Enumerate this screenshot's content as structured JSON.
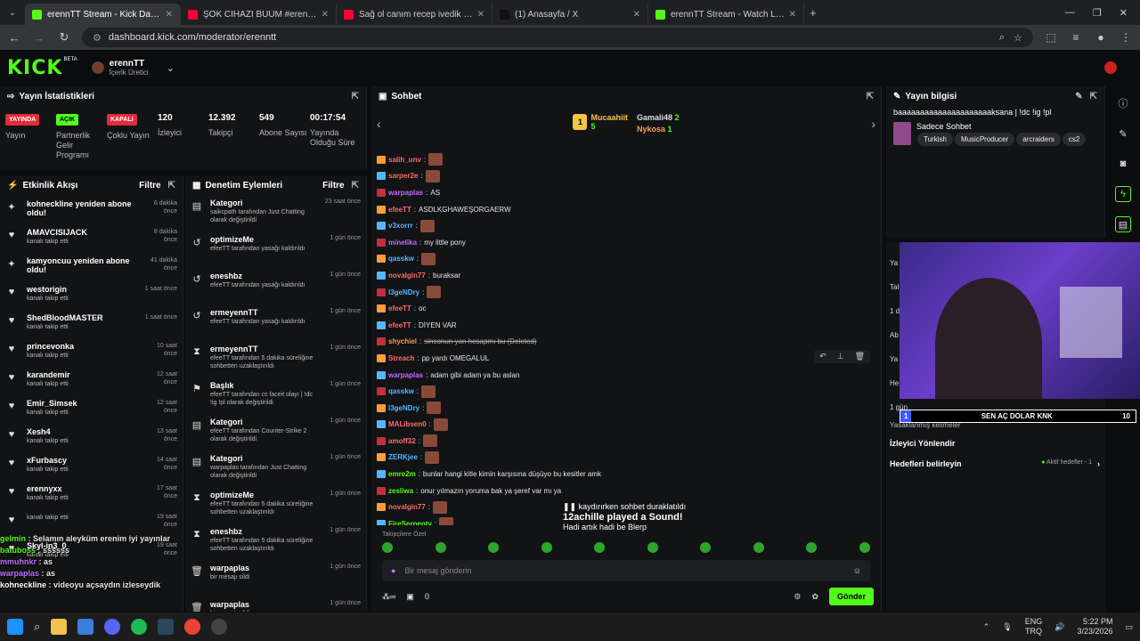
{
  "browser": {
    "tabs": [
      {
        "title": "erennTT Stream - Kick Dashbo",
        "fav": "#53fc18",
        "active": true
      },
      {
        "title": "ŞOK CİHAZI BUUM #erenntt #k",
        "fav": "#ff0033",
        "active": false
      },
      {
        "title": "Sağ ol canım recep ivedik - You",
        "fav": "#ff0033",
        "active": false
      },
      {
        "title": "(1) Anasayfa / X",
        "fav": "#111",
        "active": false
      },
      {
        "title": "erennTT Stream - Watch Live o",
        "fav": "#53fc18",
        "active": false
      }
    ],
    "url": "dashboard.kick.com/moderator/erenntt"
  },
  "header": {
    "logo": "KICK",
    "beta": "BETA",
    "channel": "erennTT",
    "role": "İçerik Üretici"
  },
  "stats": {
    "title": "Yayın İstatistikleri",
    "items": [
      {
        "badge": "YAYINDA",
        "badge_color": "#e22c3a",
        "label": "Yayın"
      },
      {
        "badge": "AÇIK",
        "badge_color": "#53fc18",
        "label": "Partnerlik Gelir Programı"
      },
      {
        "badge": "KAPALI",
        "badge_color": "#e22c3a",
        "label": "Çoklu Yayın"
      },
      {
        "value": "120",
        "label": "İzleyici"
      },
      {
        "value": "12.392",
        "label": "Takipçi"
      },
      {
        "value": "549",
        "label": "Abone Sayısı"
      },
      {
        "value": "00:17:54",
        "label": "Yayında Olduğu Süre"
      }
    ]
  },
  "activity": {
    "title": "Etkinlik Akışı",
    "filter": "Filtre",
    "items": [
      {
        "icon": "✦",
        "title": "kohneckline yeniden abone oldu!",
        "sub": "3 aylık abone oldular",
        "time": "6 dakika önce"
      },
      {
        "icon": "♥",
        "title": "AMAVCISIJACK",
        "sub": "kanalı takip etti",
        "time": "8 dakika önce"
      },
      {
        "icon": "✦",
        "title": "kamyoncuu yeniden abone oldu!",
        "sub": "5 aylık abone oldular",
        "time": "41 dakika önce"
      },
      {
        "icon": "♥",
        "title": "westorigin",
        "sub": "kanalı takip etti",
        "time": "1 saat önce"
      },
      {
        "icon": "♥",
        "title": "ShedBloodMASTER",
        "sub": "kanalı takip etti",
        "time": "1 saat önce"
      },
      {
        "icon": "♥",
        "title": "princevonka",
        "sub": "kanalı takip etti",
        "time": "10 saat önce"
      },
      {
        "icon": "♥",
        "title": "karandemir",
        "sub": "kanalı takip etti",
        "time": "12 saat önce"
      },
      {
        "icon": "♥",
        "title": "Emir_Simsek",
        "sub": "kanalı takip etti",
        "time": "12 saat önce"
      },
      {
        "icon": "♥",
        "title": "Xesh4",
        "sub": "kanalı takip etti",
        "time": "13 saat önce"
      },
      {
        "icon": "♥",
        "title": "xFurbascy",
        "sub": "kanalı takip etti",
        "time": "14 saat önce"
      },
      {
        "icon": "♥",
        "title": "erennyxx",
        "sub": "kanalı takip etti",
        "time": "17 saat önce"
      },
      {
        "icon": "♥",
        "title": "",
        "sub": "kanalı takip etti",
        "time": "19 saat önce"
      },
      {
        "icon": "♥",
        "title": "Skyl-in3_0",
        "sub": "kanalı takip etti",
        "time": "19 saat önce"
      }
    ]
  },
  "moderation": {
    "title": "Denetim Eylemleri",
    "filter": "Filtre",
    "items": [
      {
        "icon": "▤",
        "title": "Kategori",
        "sub": "saikcpath tarafından Just Chatting olarak değiştirildi",
        "time": "23 saat önce"
      },
      {
        "icon": "↺",
        "title": "optimizeMe",
        "sub": "efeeTT tarafından yasağı kaldırıldı",
        "time": "1 gün önce"
      },
      {
        "icon": "↺",
        "title": "eneshbz",
        "sub": "efeeTT tarafından yasağı kaldırıldı",
        "time": "1 gün önce"
      },
      {
        "icon": "↺",
        "title": "ermeyennTT",
        "sub": "efeeTT tarafından yasağı kaldırıldı",
        "time": "1 gün önce"
      },
      {
        "icon": "⧗",
        "title": "ermeyennTT",
        "sub": "efeeTT tarafından 5 dakika süreliğine sohbetten uzaklaştırıldı",
        "time": "1 gün önce"
      },
      {
        "icon": "⚑",
        "title": "Başlık",
        "sub": "efeeTT tarafından cs faceit olayı | !dc !ig !pl olarak değiştirildi",
        "time": "1 gün önce"
      },
      {
        "icon": "▤",
        "title": "Kategori",
        "sub": "efeeTT tarafından Counter-Strike 2 olarak değiştirildi",
        "time": "1 gün önce"
      },
      {
        "icon": "▤",
        "title": "Kategori",
        "sub": "warpaplas tarafından Just Chatting olarak değiştirildi",
        "time": "1 gün önce"
      },
      {
        "icon": "⧗",
        "title": "optimizeMe",
        "sub": "efeeTT tarafından 5 dakika süreliğine sohbetten uzaklaştırıldı",
        "time": "1 gün önce"
      },
      {
        "icon": "⧗",
        "title": "eneshbz",
        "sub": "efeeTT tarafından 5 dakika süreliğine sohbetten uzaklaştırıldı",
        "time": "1 gün önce"
      },
      {
        "icon": "🗑",
        "title": "warpaplas",
        "sub": "bir mesajı sildi",
        "time": "1 gün önce"
      },
      {
        "icon": "🗑",
        "title": "warpaplas",
        "sub": "bir mesajı sildi",
        "time": "1 gün önce"
      }
    ]
  },
  "chat": {
    "title": "Sohbet",
    "podium": [
      {
        "name": "Mucaahiit",
        "count": "5",
        "color": "#f5c542"
      },
      {
        "name": "Gamali48",
        "count": "2",
        "color": "#ddd"
      },
      {
        "name": "Nykosa",
        "count": "1",
        "color": "#f5a050"
      }
    ],
    "messages": [
      {
        "user": "salih_unv",
        "color": "#ff6b6b",
        "text": "",
        "emote": true
      },
      {
        "user": "sarper2e",
        "color": "#ff6b6b",
        "text": "",
        "emote": true
      },
      {
        "user": "warpaplas",
        "color": "#c26bff",
        "text": "AS",
        "emote": false
      },
      {
        "user": "efeeTT",
        "color": "#ff6b6b",
        "text": "ASDLKGHAWEŞORGAERW",
        "emote": false
      },
      {
        "user": "v3xorrr",
        "color": "#53b8ff",
        "text": "",
        "emote": true
      },
      {
        "user": "minelika",
        "color": "#c26bff",
        "text": "my little pony",
        "emote": false
      },
      {
        "user": "qasskw",
        "color": "#53b8ff",
        "text": "",
        "emote": true
      },
      {
        "user": "novalgin77",
        "color": "#ff6b6b",
        "text": "buraksar",
        "emote": false
      },
      {
        "user": "l3geNDry",
        "color": "#53b8ff",
        "text": "",
        "emote": true
      },
      {
        "user": "efeeTT",
        "color": "#ff6b6b",
        "text": "oc",
        "emote": false
      },
      {
        "user": "efeeTT",
        "color": "#ff6b6b",
        "text": "DİYEN VAR",
        "emote": false
      },
      {
        "user": "shychiel",
        "color": "#ff9d3b",
        "text": "sinconun yan hesapmı bu (Deleted)",
        "emote": false
      },
      {
        "user": "Streach",
        "color": "#ff6b6b",
        "text": "pp yardı OMEGALUL",
        "emote": false
      },
      {
        "user": "warpaplas",
        "color": "#c26bff",
        "text": "adam gibi adam ya bu aslan",
        "emote": false
      },
      {
        "user": "qasskw",
        "color": "#53b8ff",
        "text": "",
        "emote": true
      },
      {
        "user": "l3geNDry",
        "color": "#53b8ff",
        "text": "",
        "emote": true
      },
      {
        "user": "MALibsen0",
        "color": "#ff6b6b",
        "text": "",
        "emote": true
      },
      {
        "user": "amoff32",
        "color": "#ff6b6b",
        "text": "",
        "emote": true
      },
      {
        "user": "ZERKjee",
        "color": "#53b8ff",
        "text": "",
        "emote": true
      },
      {
        "user": "emre2m",
        "color": "#53fc18",
        "text": "bunlar hangi kitle kimin karşısına düşüyo bu kesitler amk",
        "emote": false
      },
      {
        "user": "zesliwa",
        "color": "#53fc18",
        "text": "onur yılmazın yoruma bak ya şeref var mı ya",
        "emote": false
      },
      {
        "user": "novalgin77",
        "color": "#ff6b6b",
        "text": "",
        "emote": true
      },
      {
        "user": "FireSerpentv",
        "color": "#53fc18",
        "text": "",
        "emote": true
      }
    ],
    "pause": "kaydırırken sohbet duraklatıldı",
    "sound_title": "12achille played a Sound!",
    "sound_text": "Hadi artık hadi be Blerp",
    "followers_only": "Takipçilere Özel",
    "input_placeholder": "Bir mesaj gönderin",
    "foot_count": "0",
    "send": "Gönder"
  },
  "info": {
    "title": "Yayın bilgisi",
    "stream_title": "baaaaaaaaaaaaaaaaaaaaaksana | !dc !ig !pl",
    "category": "Sadece Sohbet",
    "tags": [
      "Turkish",
      "MusicProducer",
      "arcraiders",
      "cs2"
    ]
  },
  "lower": {
    "redirect": "İzleyici Yönlendir",
    "goals": "Hedefleri belirleyin",
    "goals_active": "Aktif hedefler - 1",
    "banned_words": "Yasaklanmış kelimeler",
    "partial": [
      "Ya",
      "Tal",
      "1 d",
      "Ab",
      "Ya",
      "He",
      "1 gün"
    ]
  },
  "overlay": {
    "rank": "1",
    "text": "SEN AÇ DOLAR KNK",
    "count": "10"
  },
  "overlay_chat": [
    {
      "user": "gelmin",
      "text": "Selamın aleyküm erenim iyi yayınlar",
      "color": "#53fc18"
    },
    {
      "user": "batuboss",
      "text": "ssssss",
      "color": "#53fc18"
    },
    {
      "user": "mmuhnkr",
      "text": "as",
      "color": "#c26bff"
    },
    {
      "user": "warpaplas",
      "text": "as",
      "color": "#c26bff"
    },
    {
      "user": "kohneckline",
      "text": "videoyu açsaydın izleseydik",
      "color": "#fff"
    }
  ],
  "taskbar": {
    "lang1": "ENG",
    "lang2": "TRQ",
    "time": "5:22 PM",
    "date": "3/23/2026"
  }
}
